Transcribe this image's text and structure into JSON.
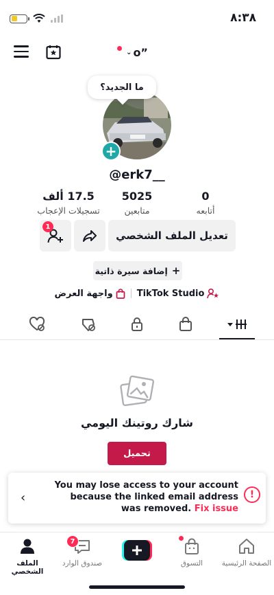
{
  "status_bar": {
    "time": "٨:٣٨"
  },
  "top_bar": {
    "account_name": "o”"
  },
  "bubble": {
    "text": "ما الجديد؟"
  },
  "profile": {
    "username": "@erk7__"
  },
  "stats": [
    {
      "value": "0",
      "label": "أتابعه"
    },
    {
      "value": "5025",
      "label": "متابعين"
    },
    {
      "value": "17.5 ألف",
      "label": "تسجيلات الإعجاب"
    }
  ],
  "actions": {
    "edit_profile": "تعديل الملف الشخصي",
    "add_friends_badge": "1"
  },
  "bio": {
    "add_label": "إضافة سيرة ذاتية"
  },
  "links": {
    "tiktok_studio": "TikTok Studio",
    "showcase": "واجهة العرض"
  },
  "empty_state": {
    "title": "شارك روتينك اليومي",
    "upload": "تحميل"
  },
  "banner": {
    "message": "You may lose access to your account because the linked email address was removed.",
    "fix": "Fix issue"
  },
  "bottom_nav": {
    "home": "الصفحة الرئيسية",
    "shop": "التسوق",
    "inbox": "صندوق الوارد",
    "inbox_badge": "7",
    "profile": "الملف الشخصي"
  },
  "colors": {
    "accent": "#fe2c55",
    "upload_button": "#c41a4a",
    "avatar_add": "#20a8a8"
  }
}
